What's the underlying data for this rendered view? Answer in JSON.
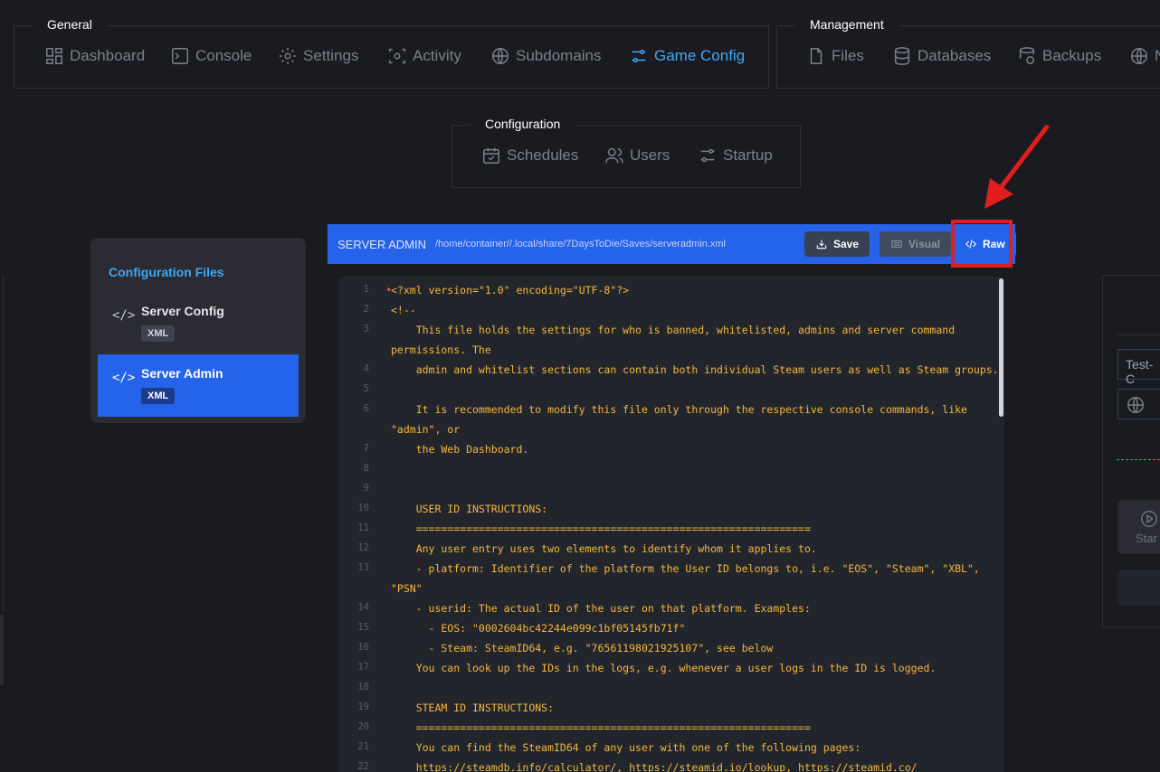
{
  "general": {
    "title": "General",
    "items": [
      {
        "label": "Dashboard"
      },
      {
        "label": "Console"
      },
      {
        "label": "Settings"
      },
      {
        "label": "Activity"
      },
      {
        "label": "Subdomains"
      },
      {
        "label": "Game Config"
      }
    ]
  },
  "management": {
    "title": "Management",
    "items": [
      {
        "label": "Files"
      },
      {
        "label": "Databases"
      },
      {
        "label": "Backups"
      },
      {
        "label": "N"
      }
    ]
  },
  "configuration": {
    "title": "Configuration",
    "items": [
      {
        "label": "Schedules"
      },
      {
        "label": "Users"
      },
      {
        "label": "Startup"
      }
    ]
  },
  "sidebar": {
    "title": "Configuration Files",
    "files": [
      {
        "icon": "</>",
        "name": "Server Config",
        "badge": "XML"
      },
      {
        "icon": "</>",
        "name": "Server Admin",
        "badge": "XML"
      }
    ]
  },
  "editor": {
    "title": "SERVER ADMIN",
    "path": "/home/container//.local/share/7DaysToDie/Saves/serveradmin.xml",
    "save_label": "Save",
    "visual_label": "Visual",
    "raw_label": "Raw",
    "lines": [
      {
        "n": "1",
        "text": "<?xml version=\"1.0\" encoding=\"UTF-8\"?>"
      },
      {
        "n": "2",
        "text": "<!--"
      },
      {
        "n": "3",
        "text": "    This file holds the settings for who is banned, whitelisted, admins and server command"
      },
      {
        "n": "",
        "text": "permissions. The"
      },
      {
        "n": "4",
        "text": "    admin and whitelist sections can contain both individual Steam users as well as Steam groups."
      },
      {
        "n": "5",
        "text": ""
      },
      {
        "n": "6",
        "text": "    It is recommended to modify this file only through the respective console commands, like"
      },
      {
        "n": "",
        "text": "\"admin\", or"
      },
      {
        "n": "7",
        "text": "    the Web Dashboard."
      },
      {
        "n": "8",
        "text": ""
      },
      {
        "n": "9",
        "text": ""
      },
      {
        "n": "10",
        "text": "    USER ID INSTRUCTIONS:"
      },
      {
        "n": "11",
        "text": "    ==============================================================="
      },
      {
        "n": "12",
        "text": "    Any user entry uses two elements to identify whom it applies to."
      },
      {
        "n": "13",
        "text": "    - platform: Identifier of the platform the User ID belongs to, i.e. \"EOS\", \"Steam\", \"XBL\","
      },
      {
        "n": "",
        "text": "\"PSN\""
      },
      {
        "n": "14",
        "text": "    - userid: The actual ID of the user on that platform. Examples:"
      },
      {
        "n": "15",
        "text": "      - EOS: \"0002604bc42244e099c1bf05145fb71f\""
      },
      {
        "n": "16",
        "text": "      - Steam: SteamID64, e.g. \"76561198021925107\", see below"
      },
      {
        "n": "17",
        "text": "    You can look up the IDs in the logs, e.g. whenever a user logs in the ID is logged."
      },
      {
        "n": "18",
        "text": ""
      },
      {
        "n": "19",
        "text": "    STEAM ID INSTRUCTIONS:"
      },
      {
        "n": "20",
        "text": "    ==============================================================="
      },
      {
        "n": "21",
        "text": "    You can find the SteamID64 of any user with one of the following pages:"
      },
      {
        "n": "22",
        "text": "    https://steamdb.info/calculator/, https://steamid.io/lookup, https://steamid.co/"
      }
    ]
  },
  "right_panel": {
    "input_value": "Test-C",
    "start_label": "Star"
  },
  "colors": {
    "accent": "#3fa8f4",
    "primary": "#2563eb",
    "code": "#f3b83a",
    "highlight": "#e11d1d"
  }
}
